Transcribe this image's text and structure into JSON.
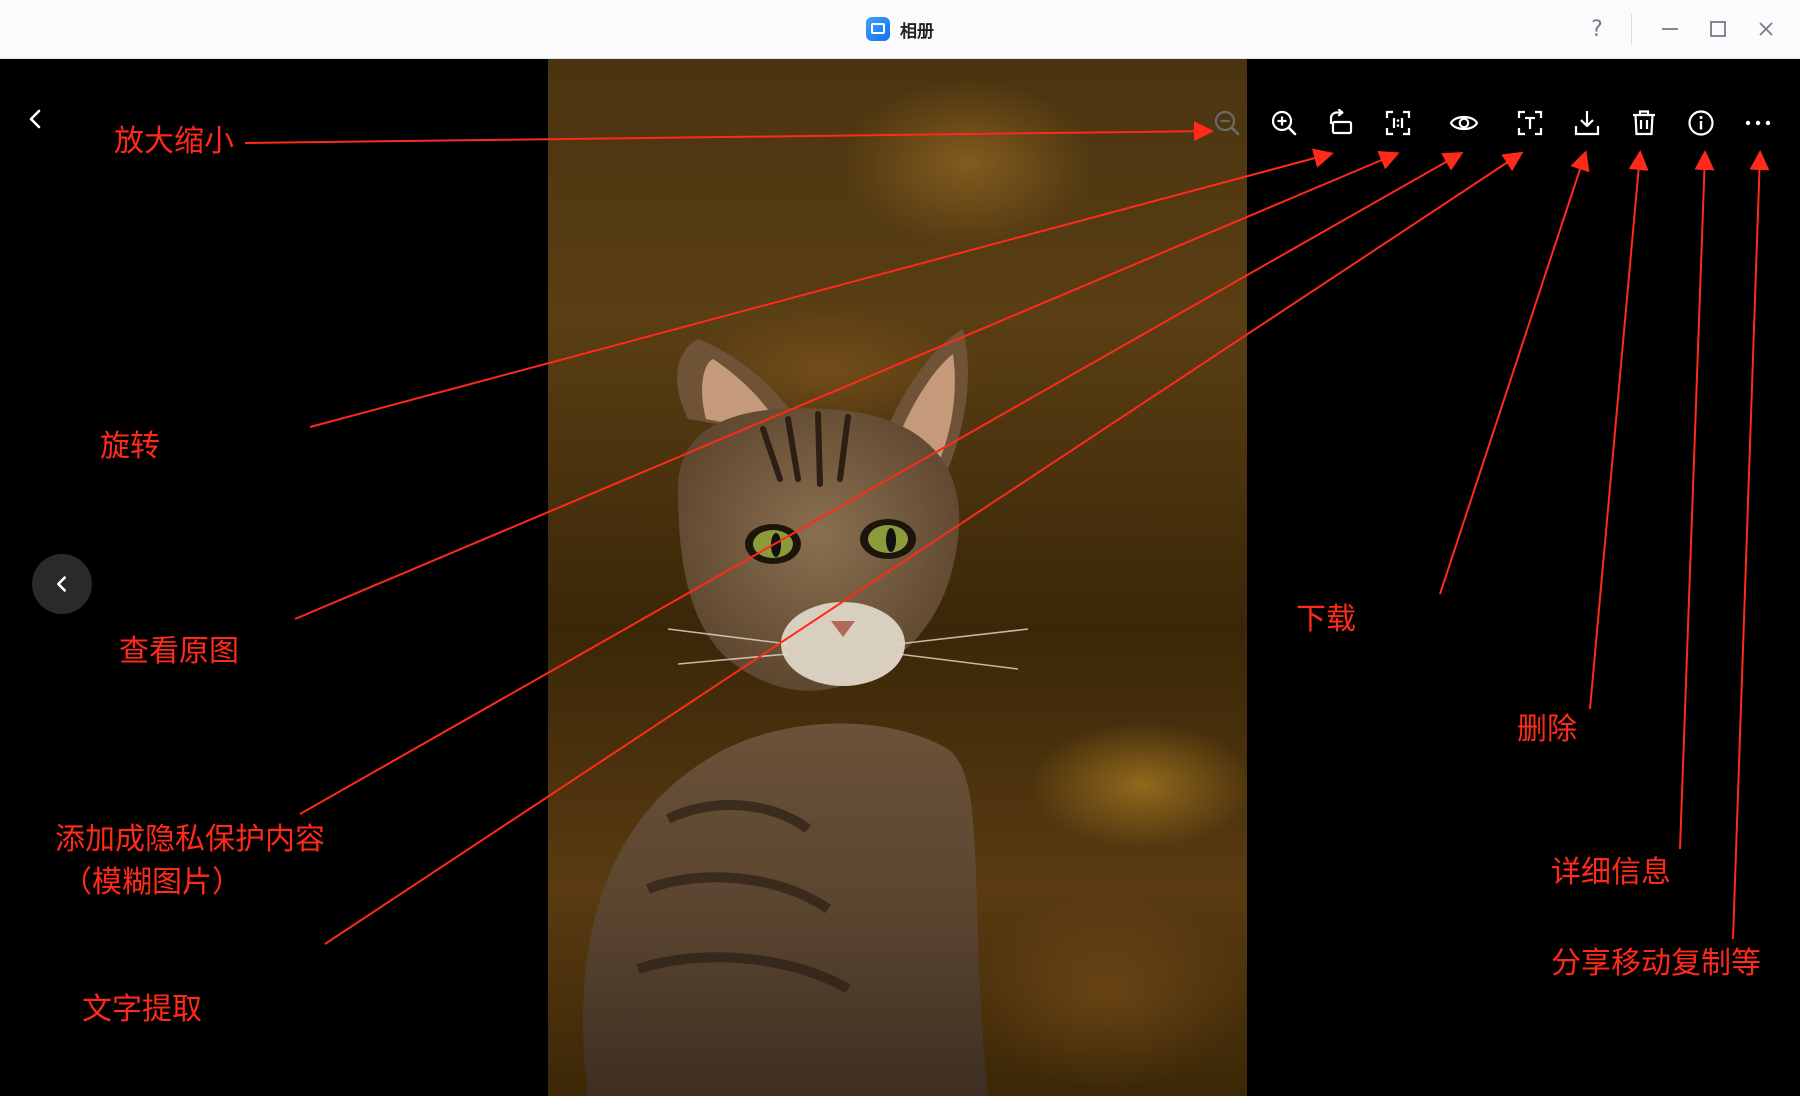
{
  "window": {
    "title": "相册",
    "controls": {
      "help": "?",
      "minimize": "minimize-icon",
      "maximize": "maximize-icon",
      "close": "close-icon"
    }
  },
  "viewer": {
    "nav": {
      "back_icon": "chevron-left-icon",
      "previous_icon": "chevron-left-icon"
    },
    "toolbar": [
      {
        "id": "zoom-out",
        "icon": "zoom-out-icon",
        "enabled": false
      },
      {
        "id": "zoom-in",
        "icon": "zoom-in-icon",
        "enabled": true
      },
      {
        "id": "rotate",
        "icon": "rotate-icon",
        "enabled": true
      },
      {
        "id": "original",
        "icon": "original-size-icon",
        "enabled": true
      },
      {
        "id": "privacy",
        "icon": "eye-icon",
        "enabled": true
      },
      {
        "id": "text-extract",
        "icon": "text-extract-icon",
        "enabled": true
      },
      {
        "id": "download",
        "icon": "download-icon",
        "enabled": true
      },
      {
        "id": "delete",
        "icon": "trash-icon",
        "enabled": true
      },
      {
        "id": "info",
        "icon": "info-icon",
        "enabled": true
      },
      {
        "id": "more",
        "icon": "more-icon",
        "enabled": true
      }
    ]
  },
  "annotations": {
    "color": "#ff2a1a",
    "zoom": "放大缩小",
    "rotate": "旋转",
    "original": "查看原图",
    "privacy_line1": "添加成隐私保护内容",
    "privacy_line2": "（模糊图片）",
    "text_extract": "文字提取",
    "download": "下载",
    "delete": "删除",
    "info": "详细信息",
    "more": "分享移动复制等"
  },
  "colors": {
    "titlebar_bg": "#fbfbfd",
    "viewer_bg": "#000000",
    "accent": "#1671ea"
  }
}
